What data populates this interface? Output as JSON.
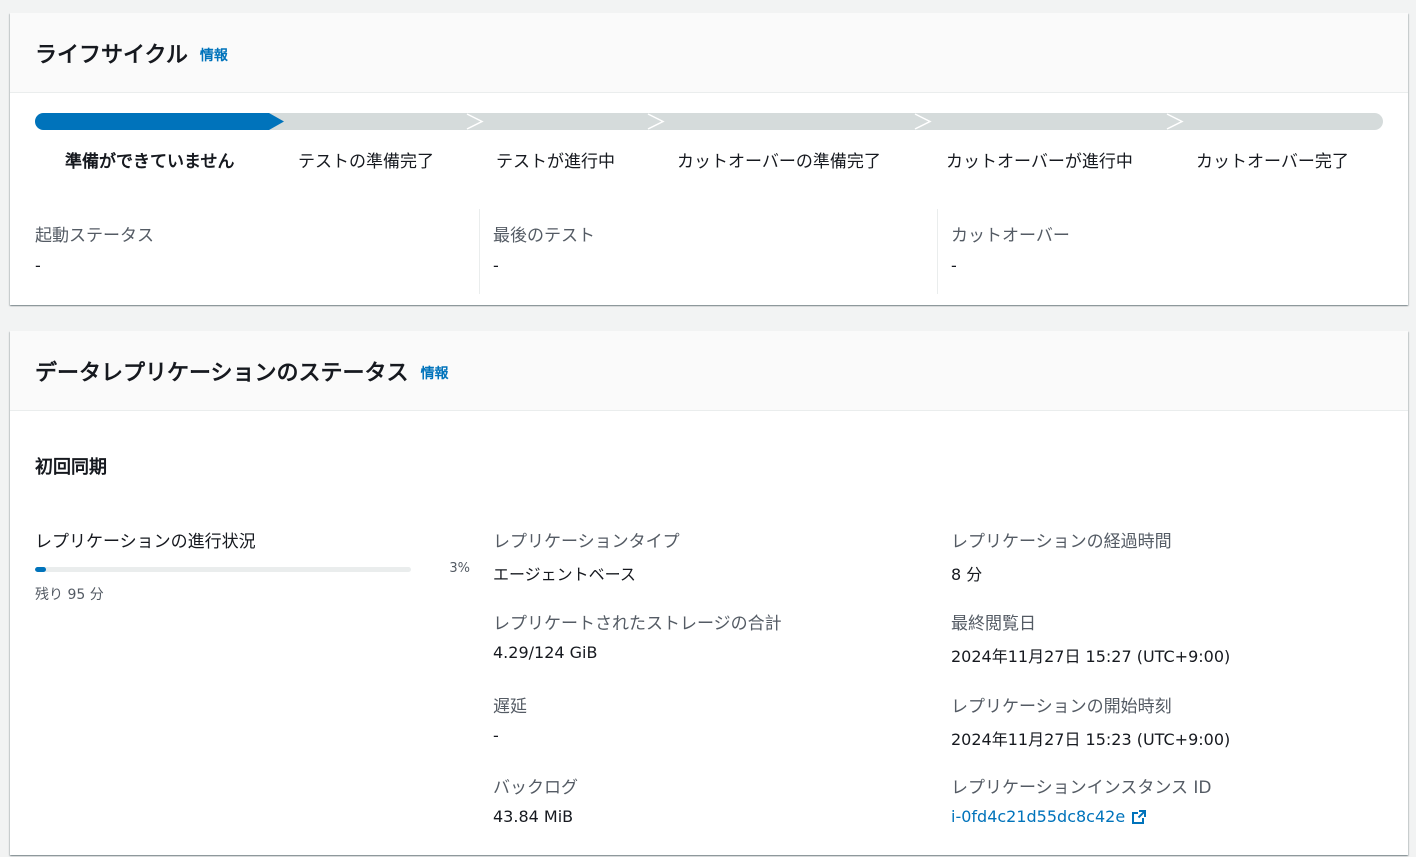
{
  "lifecycle": {
    "title": "ライフサイクル",
    "info": "情報",
    "steps": [
      "準備ができていません",
      "テストの準備完了",
      "テストが進行中",
      "カットオーバーの準備完了",
      "カットオーバーが進行中",
      "カットオーバー完了"
    ],
    "active_step_index": 0,
    "details": [
      {
        "label": "起動ステータス",
        "value": "-"
      },
      {
        "label": "最後のテスト",
        "value": "-"
      },
      {
        "label": "カットオーバー",
        "value": "-"
      }
    ]
  },
  "replication": {
    "title": "データレプリケーションのステータス",
    "info": "情報",
    "section_title": "初回同期",
    "progress": {
      "label": "レプリケーションの進行状況",
      "percent": 3,
      "percent_text": "3%",
      "remaining": "残り 95 分"
    },
    "fields": {
      "replication_type": {
        "label": "レプリケーションタイプ",
        "value": "エージェントベース"
      },
      "replicated_storage": {
        "label": "レプリケートされたストレージの合計",
        "value": "4.29/124 GiB"
      },
      "lag": {
        "label": "遅延",
        "value": "-"
      },
      "backlog": {
        "label": "バックログ",
        "value": "43.84 MiB"
      },
      "elapsed": {
        "label": "レプリケーションの経過時間",
        "value": "8 分"
      },
      "last_seen": {
        "label": "最終閲覧日",
        "value": "2024年11月27日 15:27 (UTC+9:00)"
      },
      "start_time": {
        "label": "レプリケーションの開始時刻",
        "value": "2024年11月27日 15:23 (UTC+9:00)"
      },
      "instance_id": {
        "label": "レプリケーションインスタンス ID",
        "value": "i-0fd4c21d55dc8c42e"
      }
    }
  },
  "colors": {
    "accent": "#0073bb",
    "step_inactive": "#d5dbdb",
    "link": "#0073bb"
  }
}
